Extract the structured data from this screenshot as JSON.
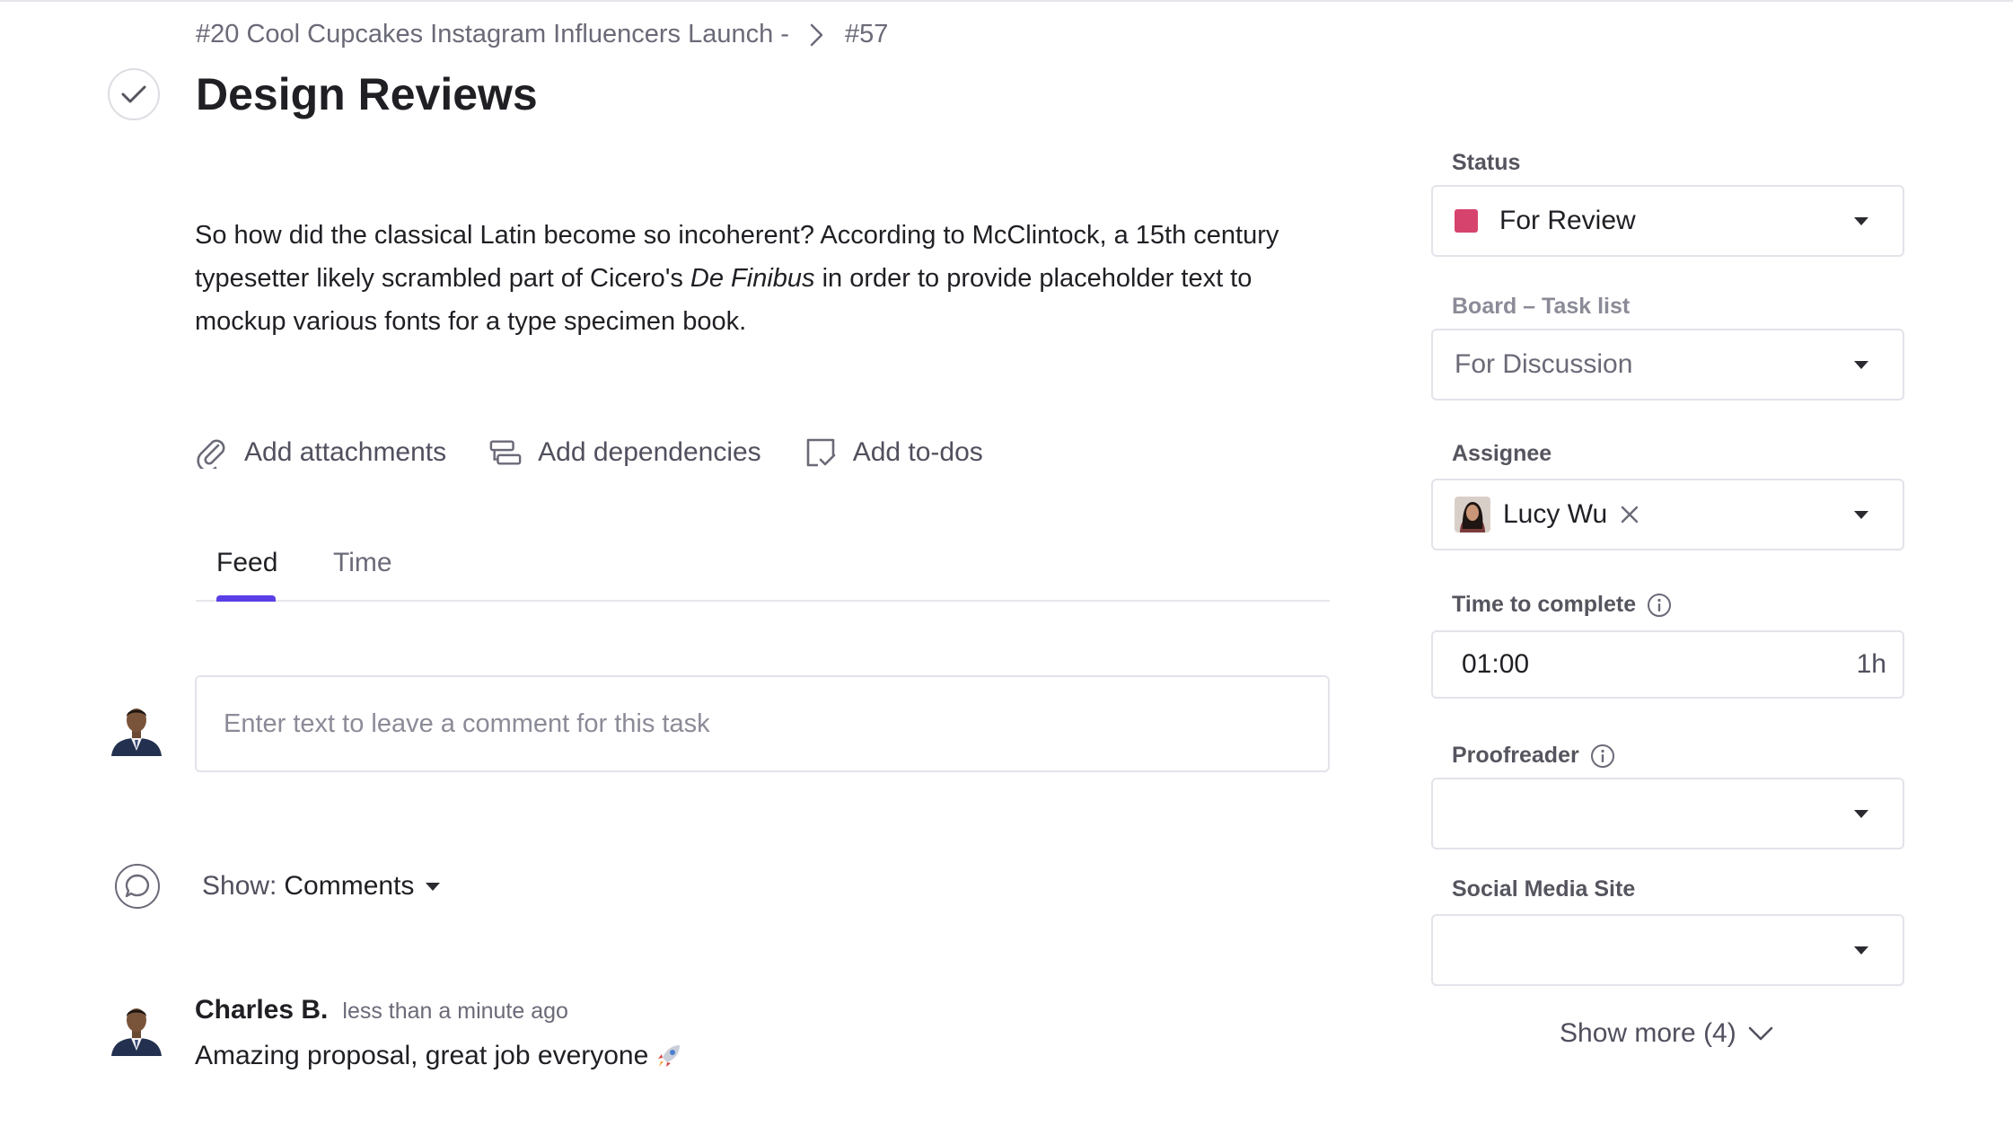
{
  "breadcrumb": {
    "project": "#20 Cool Cupcakes Instagram Influencers Launch -",
    "task_id": "#57"
  },
  "task": {
    "title": "Design Reviews",
    "description_part1": "So how did the classical Latin become so incoherent? According to McClintock, a 15th century typesetter likely scrambled part of Cicero's ",
    "description_italic": "De Finibus",
    "description_part2": " in order to provide placeholder text to mockup various fonts for a type specimen book."
  },
  "actions": {
    "attachments": "Add attachments",
    "dependencies": "Add dependencies",
    "todos": "Add to-dos"
  },
  "tabs": {
    "feed": "Feed",
    "time": "Time"
  },
  "comment": {
    "placeholder": "Enter text to leave a comment for this task"
  },
  "filter": {
    "label": "Show:",
    "value": "Comments"
  },
  "feed_items": [
    {
      "author": "Charles B.",
      "time": "less than a minute ago",
      "text": "Amazing proposal, great job everyone"
    }
  ],
  "fields": {
    "status": {
      "label": "Status",
      "value": "For Review",
      "color": "#d6446e"
    },
    "board": {
      "label": "Board – Task list",
      "value": "For Discussion"
    },
    "assignee": {
      "label": "Assignee",
      "value": "Lucy Wu"
    },
    "time_to_complete": {
      "label": "Time to complete",
      "value": "01:00",
      "unit": "1h"
    },
    "proofreader": {
      "label": "Proofreader",
      "value": ""
    },
    "social_media_site": {
      "label": "Social Media Site",
      "value": ""
    }
  },
  "show_more": "Show more (4)",
  "colors": {
    "accent": "#5b3fe6",
    "status_for_review": "#d6446e"
  },
  "icons": {
    "task_complete": "check-icon",
    "attachments": "paperclip-icon",
    "dependencies": "dependencies-icon",
    "todos": "todo-checklist-icon",
    "feed_filter": "chat-bubble-icon",
    "info": "info-icon",
    "remove": "close-icon",
    "show_more": "chevron-down-icon",
    "emoji": "rocket-icon"
  }
}
